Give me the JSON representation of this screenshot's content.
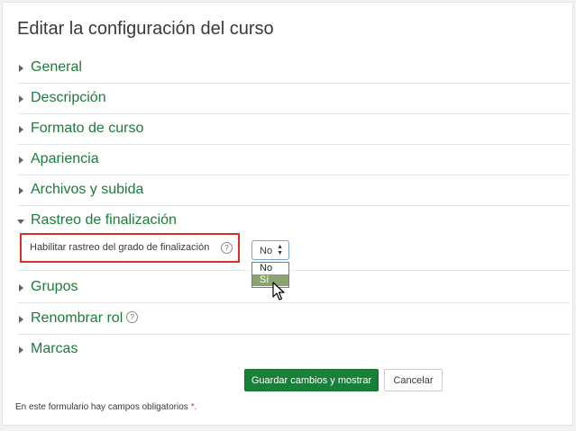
{
  "page": {
    "title": "Editar la configuración del curso"
  },
  "sections": [
    {
      "label": "General",
      "open": false
    },
    {
      "label": "Descripción",
      "open": false
    },
    {
      "label": "Formato de curso",
      "open": false
    },
    {
      "label": "Apariencia",
      "open": false
    },
    {
      "label": "Archivos y subida",
      "open": false
    },
    {
      "label": "Rastreo de finalización",
      "open": true
    },
    {
      "label": "Grupos",
      "open": false
    },
    {
      "label": "Renombrar rol",
      "open": false,
      "help": "?"
    },
    {
      "label": "Marcas",
      "open": false
    }
  ],
  "completion": {
    "field_label": "Habilitar rastreo del grado de finalización",
    "help": "?",
    "select_value": "No",
    "select_arrows": "▲▼",
    "options": [
      "No",
      "Sí"
    ],
    "highlighted_option": "Sí"
  },
  "actions": {
    "save_label": "Guardar cambios y mostrar",
    "cancel_label": "Cancelar"
  },
  "footer": {
    "required_note": "En este formulario hay campos obligatorios",
    "required_mark": "*."
  },
  "colors": {
    "accent": "#188038",
    "link": "#1e7a3b",
    "highlight_border": "#d9302c",
    "option_highlight": "#8aa36f"
  }
}
